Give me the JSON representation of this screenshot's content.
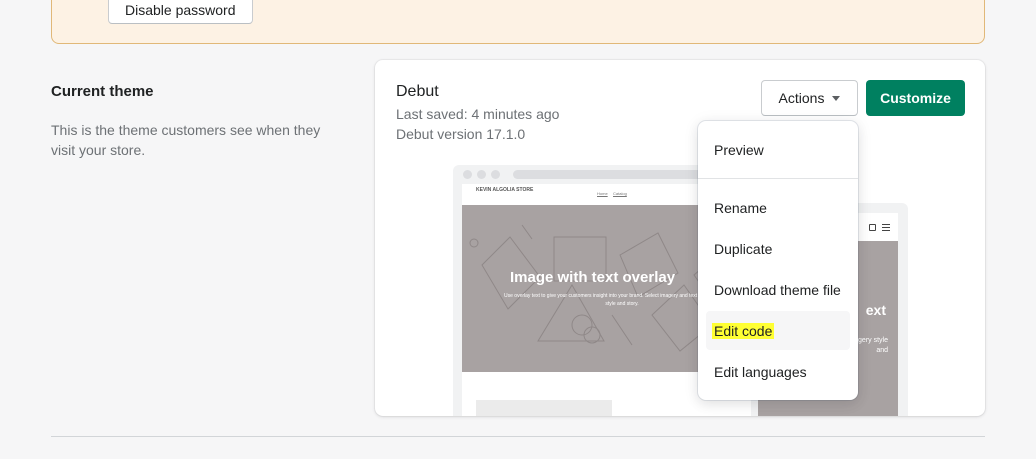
{
  "banner": {
    "disable_password_label": "Disable password"
  },
  "section": {
    "title": "Current theme",
    "description": "This is the theme customers see when they visit your store."
  },
  "theme": {
    "name": "Debut",
    "last_saved": "Last saved: 4 minutes ago",
    "version": "Debut version 17.1.0"
  },
  "buttons": {
    "actions_label": "Actions",
    "customize_label": "Customize"
  },
  "preview": {
    "store_name": "KEVIN ALGOLIA STORE",
    "nav_home": "Home",
    "nav_catalog": "Catalog",
    "hero_title": "Image with text overlay",
    "hero_subtitle": "Use overlay text to give your customers insight into your brand. Select imagery and text that relates to your style and story.",
    "mobile_title": "ext",
    "mobile_subtitle": "customers imagery style and"
  },
  "dropdown": {
    "items": [
      {
        "label": "Preview"
      },
      {
        "label": "Rename"
      },
      {
        "label": "Duplicate"
      },
      {
        "label": "Download theme file"
      },
      {
        "label": "Edit code"
      },
      {
        "label": "Edit languages"
      }
    ]
  },
  "colors": {
    "primary": "#008060",
    "banner_bg": "#fdf2e4",
    "highlight": "#ffff33"
  }
}
